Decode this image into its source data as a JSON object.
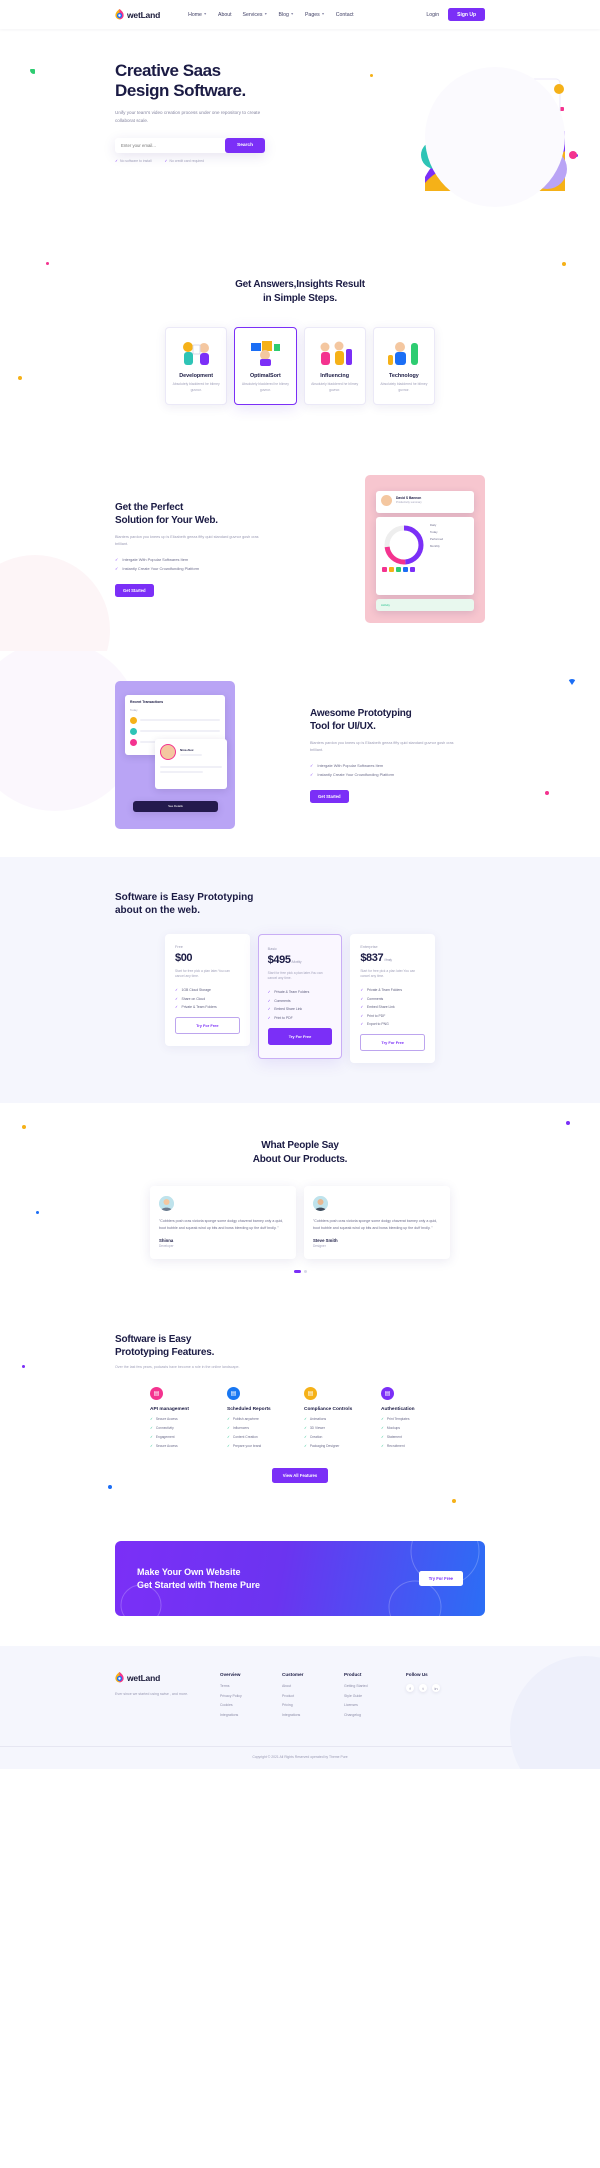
{
  "brand": {
    "name": "wetLand"
  },
  "header": {
    "nav": [
      {
        "label": "Home",
        "caret": true
      },
      {
        "label": "About",
        "caret": false
      },
      {
        "label": "Services",
        "caret": true
      },
      {
        "label": "Blog",
        "caret": true
      },
      {
        "label": "Pages",
        "caret": true
      },
      {
        "label": "Contact",
        "caret": false
      }
    ],
    "login_label": "Login",
    "signup_label": "Sign Up"
  },
  "hero": {
    "title_line1": "Creative Saas",
    "title_line2": "Design Software.",
    "subtitle": "Unify your team's video creation process under one repository to create collaborat scale.",
    "email_placeholder": "Enter your email...",
    "search_label": "Search",
    "note1": "No software to install",
    "note2": "No credit card required"
  },
  "steps": {
    "title_line1": "Get Answers,Insights Result",
    "title_line2": "in Simple Steps.",
    "cards": [
      {
        "title": "Development",
        "desc": "Absolutely bladdered he blimey guvnor.",
        "active": false
      },
      {
        "title": "OptimalSort",
        "desc": "Absolutely bladdered he blimey guvnor.",
        "active": true
      },
      {
        "title": "Influencing",
        "desc": "Absolutely bladdered he blimey guvnor.",
        "active": false
      },
      {
        "title": "Technology",
        "desc": "Absolutely bladdered he blimey guvnor.",
        "active": false
      }
    ]
  },
  "feature1": {
    "title_line1": "Get the Perfect",
    "title_line2": "Solution for Your Web.",
    "subtitle": "Blanters pardon you knees up is Elizabeth geeza fifty quid standard guvnor gosh cras brilliant.",
    "items": [
      "Intergate With Popular Softwares Item",
      "Instantly Create Your Crowdfunding Platform"
    ],
    "button": "Get Started",
    "shot": {
      "name": "David S Bannon",
      "role": "Productivity summary",
      "rows": [
        "Daily",
        "Today",
        "Performed",
        "Monthly"
      ],
      "footer": "Activity"
    }
  },
  "feature2": {
    "title_line1": "Awesome Prototyping",
    "title_line2": "Tool for UI/UX.",
    "subtitle": "Blanters pardon you knees up is Elizabeth geeza fifty quid standard guvnor gosh cras brilliant.",
    "items": [
      "Intergate With Popular Softwares Item",
      "Instantly Create Your Crowdfunding Platform"
    ],
    "button": "Get Started",
    "shot": {
      "title": "Recent Transactions",
      "subtitle": "Today",
      "card_name": "Nina Alex",
      "button": "See Details"
    }
  },
  "pricing": {
    "title_line1": "Software is Easy Prototyping",
    "title_line2": "about on the web.",
    "plans": [
      {
        "name": "Free",
        "price": "$00",
        "per": "",
        "desc": "Start for free pick a plan later.You can cancel any time.",
        "features": [
          "1GB Cloud Storage",
          "Share on Cloud",
          "Private & Team Folders"
        ],
        "button": "Try For Free",
        "featured": false
      },
      {
        "name": "Basic",
        "price": "$495",
        "per": "/Monthly",
        "desc": "Start for free pick a plan later.You can cancel any time.",
        "features": [
          "Private & Team Folders",
          "Comments",
          "Embed Share Link",
          "Print to PDF"
        ],
        "button": "Try For Free",
        "featured": true
      },
      {
        "name": "Enterprise",
        "price": "$837",
        "per": "/Yearly",
        "desc": "Start for free pick a plan later.You can cancel any time.",
        "features": [
          "Private & Team Folders",
          "Comments",
          "Embed Share Link",
          "Print to PDF",
          "Export to PNG"
        ],
        "button": "Try For Free",
        "featured": false
      }
    ]
  },
  "testimonials": {
    "title_line1": "What People Say",
    "title_line2": "About Our Products.",
    "items": [
      {
        "quote": "\"Cobblers posh cras victoria sponge some dodgy chaverat barney only a quid, boot bubble and squeak wind up bits and bows bleeding up the duff brolly. \"",
        "name": "Shinna",
        "role": "Developer"
      },
      {
        "quote": "\"Cobblers posh cras victoria sponge some dodgy chaverat barney only a quid, boot bubble and squeak wind up bits and bows bleeding up the duff brolly. \"",
        "name": "Steve Smith",
        "role": "Designer"
      }
    ]
  },
  "features": {
    "title_line1": "Software is Easy",
    "title_line2": "Prototyping Features.",
    "subtitle": "Over the last few years, podcasts have become a role in the online landscape.",
    "columns": [
      {
        "title": "API management",
        "color": "#f4338f",
        "items": [
          "Secure Access",
          "Connectivity",
          "Engagement",
          "Secure Access"
        ]
      },
      {
        "title": "Scheduled Reports",
        "color": "#1877f2",
        "items": [
          "Publish anywhere",
          "Influencers",
          "Content Creation",
          "Prepare your brand"
        ]
      },
      {
        "title": "Compliance Controls",
        "color": "#f5b118",
        "items": [
          "Animations",
          "3D Viewer",
          "Creation",
          "Packaging Designer"
        ]
      },
      {
        "title": "Authentication",
        "color": "#7b2ff7",
        "items": [
          "Print Templates",
          "Mockups",
          "Statement",
          "Recruitment"
        ]
      }
    ],
    "button": "View All Features"
  },
  "cta": {
    "title_line1": "Make Your Own Website",
    "title_line2": "Get Started with Theme Pure",
    "button": "Try For Free"
  },
  "footer": {
    "tagline": "Ever since we started using swise , and more.",
    "columns": [
      {
        "title": "Overview",
        "links": [
          "Terms",
          "Privacy Policy",
          "Cookies",
          "Integrations"
        ]
      },
      {
        "title": "Customer",
        "links": [
          "About",
          "Product",
          "Pricing",
          "Integrations"
        ]
      },
      {
        "title": "Product",
        "links": [
          "Getting Started",
          "Style Guide",
          "Licenses",
          "Changelog"
        ]
      }
    ],
    "follow_title": "Follow Us",
    "socials": [
      "f",
      "t",
      "in"
    ],
    "copyright": "Copyright © 2021 All Rights Reserved operated by Theme Pure"
  }
}
